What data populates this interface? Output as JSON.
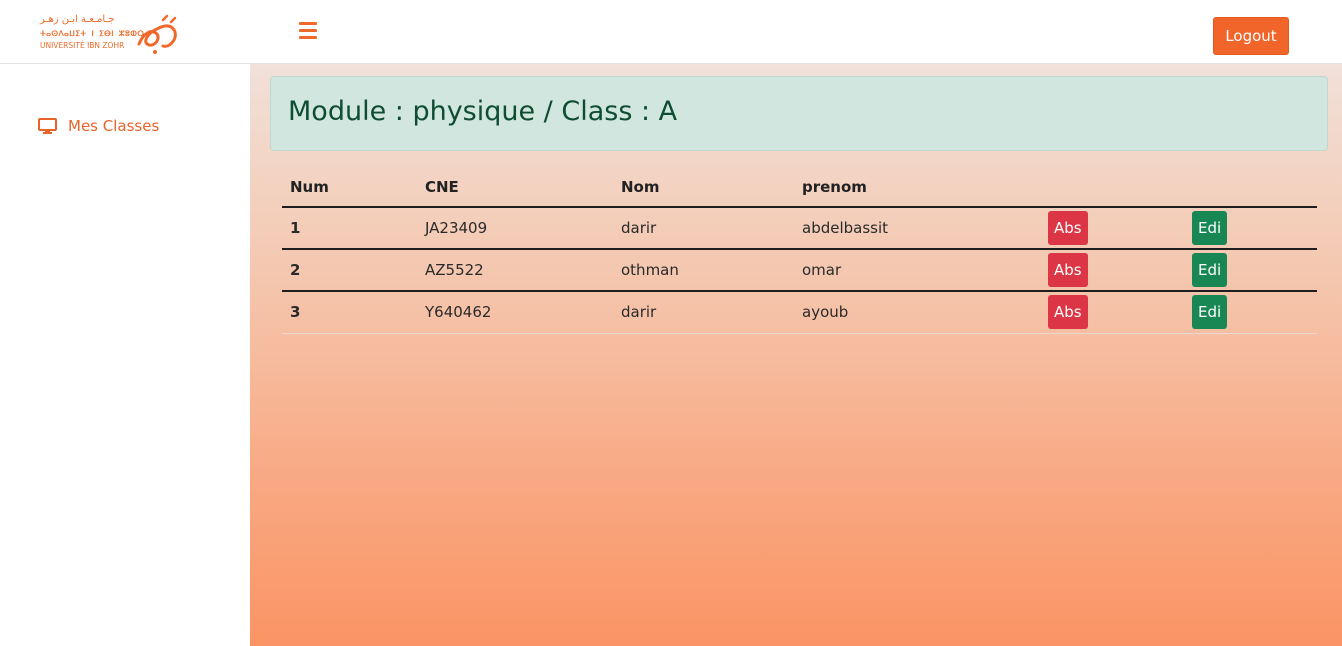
{
  "brand": {
    "line_arabic": "جـامـعـة ابـن زهـر",
    "line_tifinagh": "ⵜⴰⵙⴷⴰⵡⵉⵜ ⵏ ⵉⴱⵏ ⵣⵓⵀⵔ",
    "line_latin": "UNIVERSITÉ IBN ZOHR",
    "color": "#ef6a2a"
  },
  "header": {
    "menu_icon": "hamburger-icon",
    "logout_label": "Logout"
  },
  "sidebar": {
    "items": [
      {
        "label": "Mes Classes",
        "icon": "monitor-icon"
      }
    ]
  },
  "main": {
    "title": "Module : physique / Class : A",
    "table": {
      "columns": [
        "Num",
        "CNE",
        "Nom",
        "prenom",
        "",
        ""
      ],
      "rows": [
        {
          "num": "1",
          "cne": "JA23409",
          "nom": "darir",
          "prenom": "abdelbassit",
          "abs_label": "Abs",
          "edit_label": "Edi"
        },
        {
          "num": "2",
          "cne": "AZ5522",
          "nom": "othman",
          "prenom": "omar",
          "abs_label": "Abs",
          "edit_label": "Edi"
        },
        {
          "num": "3",
          "cne": "Y640462",
          "nom": "darir",
          "prenom": "ayoub",
          "abs_label": "Abs",
          "edit_label": "Edi"
        }
      ]
    }
  },
  "colors": {
    "accent": "#ef6a2a",
    "abs_button": "#dc3545",
    "edit_button": "#198754",
    "header_box": "#d1e6df",
    "title_text": "#0f4d32"
  }
}
